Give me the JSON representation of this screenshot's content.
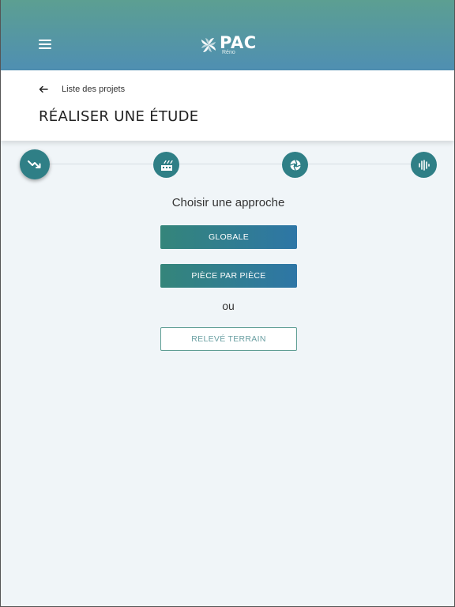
{
  "app": {
    "logo_text": "PAC",
    "logo_subtext": "Réno"
  },
  "header": {
    "back_label": "Liste des projets",
    "title": "RÉALISER UNE ÉTUDE"
  },
  "stepper": {
    "steps": [
      {
        "icon": "trending-down-icon",
        "active": true
      },
      {
        "icon": "factory-icon",
        "active": false
      },
      {
        "icon": "aperture-icon",
        "active": false
      },
      {
        "icon": "audio-wave-icon",
        "active": false
      }
    ]
  },
  "main": {
    "section_title": "Choisir une approche",
    "approach_global": "GLOBALE",
    "approach_room": "PIÈCE PAR PIÈCE",
    "or_text": "ou",
    "field_survey": "RELEVÉ TERRAIN"
  },
  "colors": {
    "accent": "#2f7f86",
    "topbar_start": "#5c9f92",
    "topbar_end": "#4f8fb2",
    "button_start": "#34857a",
    "button_end": "#2e76a6"
  }
}
